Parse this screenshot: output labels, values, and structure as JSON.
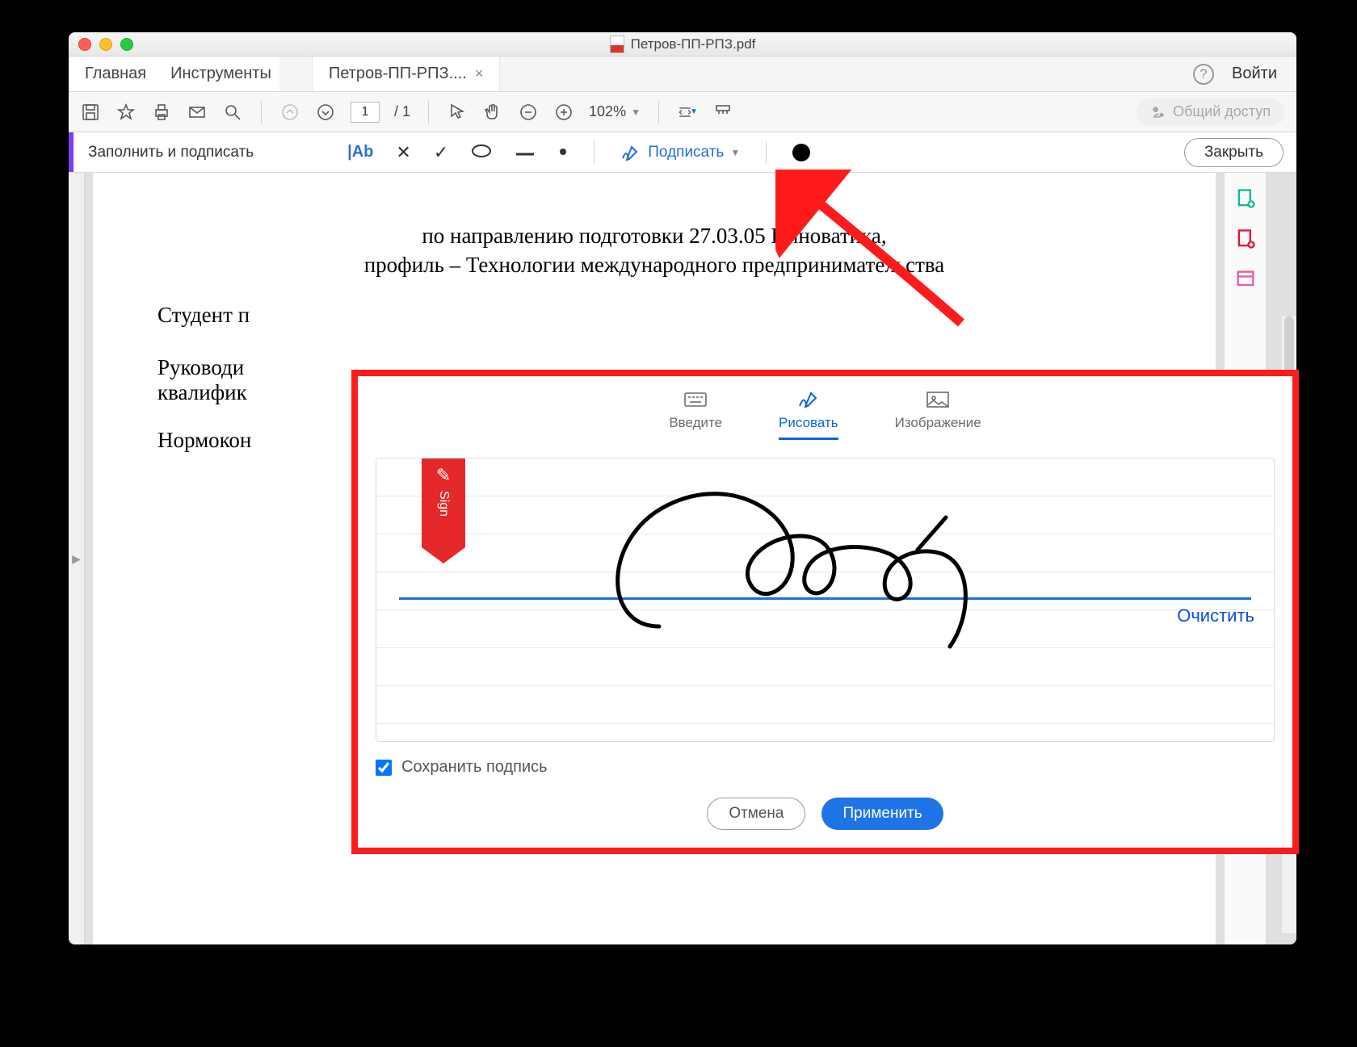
{
  "titlebar": {
    "filename": "Петров-ПП-РПЗ.pdf"
  },
  "tabs": {
    "home": "Главная",
    "tools": "Инструменты",
    "doc": "Петров-ПП-РПЗ....",
    "login": "Войти"
  },
  "toolbar": {
    "page_current": "1",
    "page_total": "1",
    "zoom": "102%",
    "share": "Общий доступ"
  },
  "fillsign": {
    "title": "Заполнить и подписать",
    "text_tool": "|Ab",
    "sign": "Подписать",
    "close": "Закрыть"
  },
  "document": {
    "line1": "по направлению подготовки 27.03.05 Инноватика,",
    "line2": "профиль – Технологии международного предпринимательства",
    "p1": "Студент п",
    "p2a": "Руководи",
    "p2b": "квалифик",
    "p3": "Нормокон"
  },
  "dialog": {
    "tab_type": "Введите",
    "tab_draw": "Рисовать",
    "tab_image": "Изображение",
    "bookmark": "Sign",
    "clear": "Очистить",
    "save": "Сохранить подпись",
    "cancel": "Отмена",
    "apply": "Применить"
  }
}
